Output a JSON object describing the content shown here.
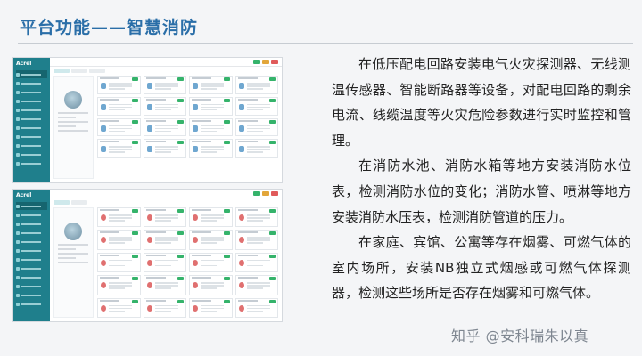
{
  "slide": {
    "title": "平台功能——智慧消防",
    "paragraphs": [
      "在低压配电回路安装电气火灾探测器、无线测温传感器、智能断路器等设备，对配电回路的剩余电流、线缆温度等火灾危险参数进行实时监控和管理。",
      "在消防水池、消防水箱等地方安装消防水位表，检测消防水位的变化；消防水管、喷淋等地方安装消防水压表，检测消防管道的压力。",
      "在家庭、宾馆、公寓等存在烟雾、可燃气体的室内场所，安装NB独立式烟感或可燃气体探测器，检测这些场所是否存在烟雾和可燃气体。"
    ],
    "watermark": "知乎 @安科瑞朱以真"
  },
  "screenshots": {
    "logo": "Acrel",
    "colors": {
      "sidebar": "#1f7f8c",
      "accent": "#2a6ea8",
      "ok": "#35b36b",
      "warn": "#e2a63a"
    }
  }
}
